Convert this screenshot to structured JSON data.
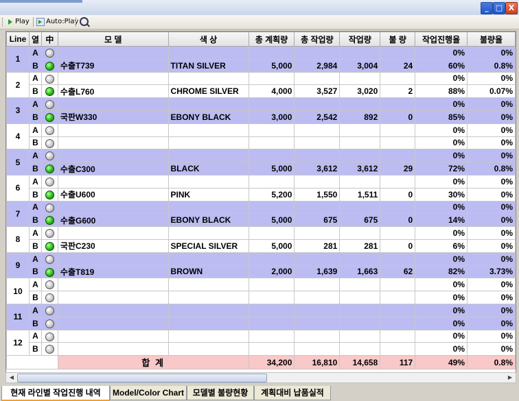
{
  "toolbar": {
    "play_label": "Play",
    "autoplay_label": "Auto:Play"
  },
  "window_controls": {
    "minimize": "_",
    "maximize": "□",
    "close": "X"
  },
  "table": {
    "headers": [
      "Line",
      "열",
      "中",
      "모 델",
      "색 상",
      "총 계획량",
      "총 작업량",
      "작업량",
      "불 량",
      "작업진행율",
      "불량율"
    ],
    "lines": [
      {
        "line": "1",
        "band": true,
        "rows": [
          {
            "ab": "A",
            "on": false,
            "model": "",
            "color": "",
            "plan": "",
            "total": "",
            "work": "",
            "defect": "",
            "progress": "0%",
            "defect_rate": "0%"
          },
          {
            "ab": "B",
            "on": true,
            "model": "수출T739",
            "color": "TITAN SILVER",
            "plan": "5,000",
            "total": "2,984",
            "work": "3,004",
            "defect": "24",
            "progress": "60%",
            "defect_rate": "0.8%"
          }
        ]
      },
      {
        "line": "2",
        "band": false,
        "rows": [
          {
            "ab": "A",
            "on": false,
            "model": "",
            "color": "",
            "plan": "",
            "total": "",
            "work": "",
            "defect": "",
            "progress": "0%",
            "defect_rate": "0%"
          },
          {
            "ab": "B",
            "on": true,
            "model": "수출L760",
            "color": "CHROME SILVER",
            "plan": "4,000",
            "total": "3,527",
            "work": "3,020",
            "defect": "2",
            "progress": "88%",
            "defect_rate": "0.07%"
          }
        ]
      },
      {
        "line": "3",
        "band": true,
        "rows": [
          {
            "ab": "A",
            "on": false,
            "model": "",
            "color": "",
            "plan": "",
            "total": "",
            "work": "",
            "defect": "",
            "progress": "0%",
            "defect_rate": "0%"
          },
          {
            "ab": "B",
            "on": true,
            "model": "국판W330",
            "color": "EBONY BLACK",
            "plan": "3,000",
            "total": "2,542",
            "work": "892",
            "defect": "0",
            "progress": "85%",
            "defect_rate": "0%"
          }
        ]
      },
      {
        "line": "4",
        "band": false,
        "rows": [
          {
            "ab": "A",
            "on": false,
            "model": "",
            "color": "",
            "plan": "",
            "total": "",
            "work": "",
            "defect": "",
            "progress": "0%",
            "defect_rate": "0%"
          },
          {
            "ab": "B",
            "on": false,
            "model": "",
            "color": "",
            "plan": "",
            "total": "",
            "work": "",
            "defect": "",
            "progress": "0%",
            "defect_rate": "0%"
          }
        ]
      },
      {
        "line": "5",
        "band": true,
        "rows": [
          {
            "ab": "A",
            "on": false,
            "model": "",
            "color": "",
            "plan": "",
            "total": "",
            "work": "",
            "defect": "",
            "progress": "0%",
            "defect_rate": "0%"
          },
          {
            "ab": "B",
            "on": true,
            "model": "수출C300",
            "color": "BLACK",
            "plan": "5,000",
            "total": "3,612",
            "work": "3,612",
            "defect": "29",
            "progress": "72%",
            "defect_rate": "0.8%"
          }
        ]
      },
      {
        "line": "6",
        "band": false,
        "rows": [
          {
            "ab": "A",
            "on": false,
            "model": "",
            "color": "",
            "plan": "",
            "total": "",
            "work": "",
            "defect": "",
            "progress": "0%",
            "defect_rate": "0%"
          },
          {
            "ab": "B",
            "on": true,
            "model": "수출U600",
            "color": "PINK",
            "plan": "5,200",
            "total": "1,550",
            "work": "1,511",
            "defect": "0",
            "progress": "30%",
            "defect_rate": "0%"
          }
        ]
      },
      {
        "line": "7",
        "band": true,
        "rows": [
          {
            "ab": "A",
            "on": false,
            "model": "",
            "color": "",
            "plan": "",
            "total": "",
            "work": "",
            "defect": "",
            "progress": "0%",
            "defect_rate": "0%"
          },
          {
            "ab": "B",
            "on": true,
            "model": "수출G600",
            "color": "EBONY BLACK",
            "plan": "5,000",
            "total": "675",
            "work": "675",
            "defect": "0",
            "progress": "14%",
            "defect_rate": "0%"
          }
        ]
      },
      {
        "line": "8",
        "band": false,
        "rows": [
          {
            "ab": "A",
            "on": false,
            "model": "",
            "color": "",
            "plan": "",
            "total": "",
            "work": "",
            "defect": "",
            "progress": "0%",
            "defect_rate": "0%"
          },
          {
            "ab": "B",
            "on": true,
            "model": "국판C230",
            "color": "SPECIAL SILVER",
            "plan": "5,000",
            "total": "281",
            "work": "281",
            "defect": "0",
            "progress": "6%",
            "defect_rate": "0%"
          }
        ]
      },
      {
        "line": "9",
        "band": true,
        "rows": [
          {
            "ab": "A",
            "on": false,
            "model": "",
            "color": "",
            "plan": "",
            "total": "",
            "work": "",
            "defect": "",
            "progress": "0%",
            "defect_rate": "0%"
          },
          {
            "ab": "B",
            "on": true,
            "model": "수출T819",
            "color": "BROWN",
            "plan": "2,000",
            "total": "1,639",
            "work": "1,663",
            "defect": "62",
            "progress": "82%",
            "defect_rate": "3.73%"
          }
        ]
      },
      {
        "line": "10",
        "band": false,
        "rows": [
          {
            "ab": "A",
            "on": false,
            "model": "",
            "color": "",
            "plan": "",
            "total": "",
            "work": "",
            "defect": "",
            "progress": "0%",
            "defect_rate": "0%"
          },
          {
            "ab": "B",
            "on": false,
            "model": "",
            "color": "",
            "plan": "",
            "total": "",
            "work": "",
            "defect": "",
            "progress": "0%",
            "defect_rate": "0%"
          }
        ]
      },
      {
        "line": "11",
        "band": true,
        "rows": [
          {
            "ab": "A",
            "on": false,
            "model": "",
            "color": "",
            "plan": "",
            "total": "",
            "work": "",
            "defect": "",
            "progress": "0%",
            "defect_rate": "0%"
          },
          {
            "ab": "B",
            "on": false,
            "model": "",
            "color": "",
            "plan": "",
            "total": "",
            "work": "",
            "defect": "",
            "progress": "0%",
            "defect_rate": "0%"
          }
        ]
      },
      {
        "line": "12",
        "band": false,
        "rows": [
          {
            "ab": "A",
            "on": false,
            "model": "",
            "color": "",
            "plan": "",
            "total": "",
            "work": "",
            "defect": "",
            "progress": "0%",
            "defect_rate": "0%"
          },
          {
            "ab": "B",
            "on": false,
            "model": "",
            "color": "",
            "plan": "",
            "total": "",
            "work": "",
            "defect": "",
            "progress": "0%",
            "defect_rate": "0%"
          }
        ]
      }
    ],
    "summary": {
      "label": "합 계",
      "plan": "34,200",
      "total": "16,810",
      "work": "14,658",
      "defect": "117",
      "progress": "49%",
      "defect_rate": "0.8%"
    }
  },
  "tabs": [
    {
      "label": "현재 라인별 작업진행 내역",
      "active": true
    },
    {
      "label": "Model/Color Chart",
      "active": false
    },
    {
      "label": "모델별 불량현황",
      "active": false
    },
    {
      "label": "계획대비 납품실적",
      "active": false
    }
  ],
  "colors": {
    "band": "#bcbcf2",
    "summary": "#f9c8c8",
    "tab_accent": "#f0a030"
  }
}
